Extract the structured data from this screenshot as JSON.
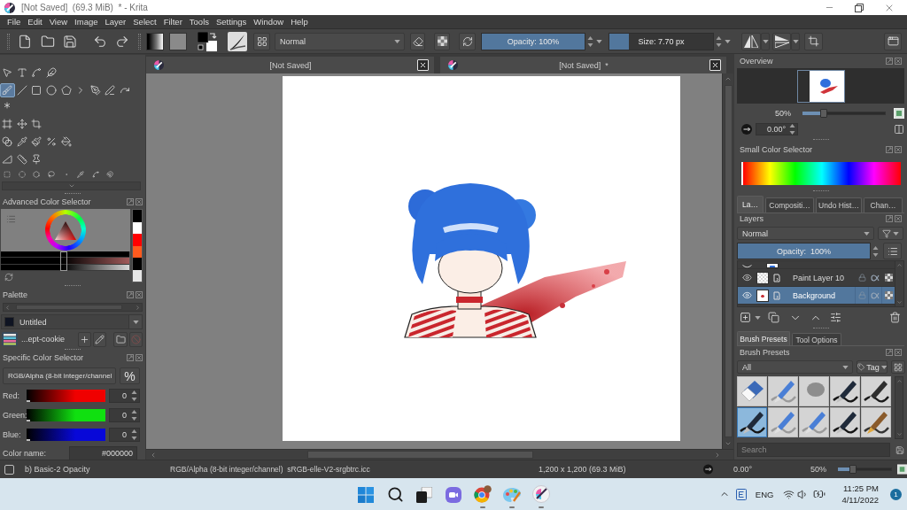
{
  "window": {
    "title": "[Not Saved]  (69.3 MiB)  * - Krita"
  },
  "menu": [
    "File",
    "Edit",
    "View",
    "Image",
    "Layer",
    "Select",
    "Filter",
    "Tools",
    "Settings",
    "Window",
    "Help"
  ],
  "toolbar": {
    "blend_mode": "Normal",
    "opacity": {
      "label": "Opacity: 100%",
      "level": 1
    },
    "size": {
      "label": "Size: 7.70 px",
      "level": 0.19
    }
  },
  "documents": [
    {
      "title": "[Not Saved]"
    },
    {
      "title": "[Not Saved]  *"
    }
  ],
  "toolbox": {
    "groups": [
      {
        "tools": [
          {
            "kind": "select",
            "selected": false
          },
          {
            "kind": "text",
            "selected": false
          },
          {
            "kind": "edit",
            "selected": false
          },
          {
            "kind": "calligraphy",
            "selected": false
          }
        ]
      },
      {
        "tools": [
          {
            "kind": "brush",
            "selected": true
          },
          {
            "kind": "line",
            "selected": false
          },
          {
            "kind": "rectangle",
            "selected": false
          },
          {
            "kind": "ellipse",
            "selected": false
          },
          {
            "kind": "polygon",
            "selected": false
          },
          {
            "kind": "polyline",
            "selected": false
          },
          {
            "kind": "bezier",
            "selected": false
          },
          {
            "kind": "path",
            "selected": false
          },
          {
            "kind": "dynamic",
            "selected": false
          },
          {
            "kind": "multibrush",
            "selected": false
          }
        ]
      },
      {
        "tools": [
          {
            "kind": "transform",
            "selected": false
          },
          {
            "kind": "move",
            "selected": false
          },
          {
            "kind": "crop",
            "selected": false
          }
        ]
      },
      {
        "tools": [
          {
            "kind": "gradient",
            "selected": false
          },
          {
            "kind": "picker",
            "selected": false
          },
          {
            "kind": "colorize",
            "selected": false
          },
          {
            "kind": "patch",
            "selected": false
          },
          {
            "kind": "fill",
            "selected": false
          }
        ]
      },
      {
        "tools": [
          {
            "kind": "assistant",
            "selected": false
          },
          {
            "kind": "measure",
            "selected": false
          },
          {
            "kind": "reference",
            "selected": false
          }
        ]
      },
      {
        "clipped": true,
        "tools": [
          {
            "kind": "rect-select",
            "selected": false
          },
          {
            "kind": "ellipse-select",
            "selected": false
          },
          {
            "kind": "polygon-select",
            "selected": false
          },
          {
            "kind": "lasso-select",
            "selected": false
          },
          {
            "kind": "contiguous-select",
            "selected": false
          },
          {
            "kind": "similar-select",
            "selected": false
          },
          {
            "kind": "bezier-select",
            "selected": false
          },
          {
            "kind": "magnetic-select",
            "selected": false
          }
        ]
      }
    ]
  },
  "advanced_color_selector": {
    "title": "Advanced Color Selector",
    "recent_colors": [
      {
        "color": "#000000"
      },
      {
        "color": "#ffffff"
      },
      {
        "color": "#ff0000"
      },
      {
        "color": "#ff5a1e"
      },
      {
        "color": "#000000"
      },
      {
        "color": "#e6e6e6"
      }
    ],
    "shade_selector": {
      "level": 0.49
    }
  },
  "palette": {
    "title": "Palette",
    "entry": "Untitled",
    "name": "...ept-cookie",
    "buttons": [
      {
        "kind": "add",
        "disabled": false
      },
      {
        "kind": "edit",
        "disabled": false
      },
      {
        "kind": "open",
        "disabled": false
      },
      {
        "kind": "remove",
        "disabled": true
      }
    ]
  },
  "specific_color_selector": {
    "title": "Specific Color Selector",
    "model": "RGB/Alpha (8-bit integer/channel",
    "unit_button": "%",
    "channels": [
      {
        "label": "Red:",
        "value": "0",
        "level": 0,
        "color": "#f00000"
      },
      {
        "label": "Green:",
        "value": "0",
        "level": 0,
        "color": "#10e010"
      },
      {
        "label": "Blue:",
        "value": "0",
        "level": 0,
        "color": "#0808d8"
      }
    ],
    "color_name_label": "Color name:",
    "color_name": "#000000"
  },
  "overview": {
    "title": "Overview",
    "zoom": {
      "label": "50%",
      "level": 0.23
    },
    "rotation": "0.00°"
  },
  "small_color_selector": {
    "title": "Small Color Selector"
  },
  "layer_tabs": [
    {
      "label": "La…",
      "selected": true
    },
    {
      "label": "Compositi…",
      "selected": false
    },
    {
      "label": "Undo Hist…",
      "selected": false
    },
    {
      "label": "Chan…",
      "selected": false
    }
  ],
  "layers": {
    "title": "Layers",
    "blend_mode": "Normal",
    "opacity": {
      "label": "Opacity:  100%",
      "level": 1
    },
    "items": [
      {
        "kind": "clipped",
        "selected": false
      },
      {
        "kind": "paint",
        "name": "Paint Layer 10",
        "selected": false
      },
      {
        "kind": "background",
        "name": "Background",
        "selected": true
      }
    ]
  },
  "preset_tabs": [
    {
      "label": "Brush Presets",
      "selected": true
    },
    {
      "label": "Tool Options",
      "selected": false
    }
  ],
  "brush_presets": {
    "title": "Brush Presets",
    "filter": "All",
    "tag_button": "Tag",
    "presets": [
      {
        "kind": "eraser",
        "selected": false
      },
      {
        "kind": "pencil",
        "selected": false
      },
      {
        "kind": "airbrush",
        "selected": false
      },
      {
        "kind": "inkpen",
        "selected": false
      },
      {
        "kind": "pen",
        "selected": false
      },
      {
        "kind": "inkpen",
        "selected": true
      },
      {
        "kind": "pencil",
        "selected": false
      },
      {
        "kind": "pencil",
        "selected": false
      },
      {
        "kind": "inkpen",
        "selected": false
      },
      {
        "kind": "brush",
        "selected": false
      }
    ],
    "search": {
      "placeholder": "Search"
    }
  },
  "status_bar": {
    "preset": "b) Basic-2 Opacity",
    "color_space": "RGB/Alpha (8-bit integer/channel)  sRGB-elle-V2-srgbtrc.icc",
    "dimensions": "1,200 x 1,200 (69.3 MiB)",
    "rotation": "0.00°",
    "zoom": {
      "label": "50%",
      "level": 0.25
    }
  },
  "taskbar": {
    "apps": [
      {
        "kind": "start",
        "running": false
      },
      {
        "kind": "search",
        "running": false
      },
      {
        "kind": "taskview",
        "running": false
      },
      {
        "kind": "chat",
        "running": false
      },
      {
        "kind": "browser",
        "running": true
      },
      {
        "kind": "paint",
        "running": true
      },
      {
        "kind": "krita",
        "running": true
      }
    ],
    "language": "ENG",
    "time": "11:25 PM",
    "date": "4/11/2022",
    "notifications": "1"
  }
}
